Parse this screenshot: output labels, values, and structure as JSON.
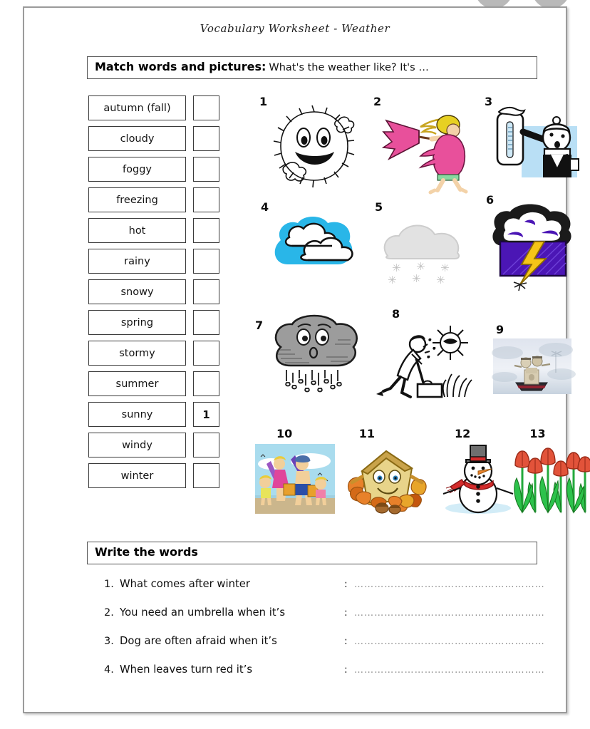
{
  "document": {
    "title": "Vocabulary Worksheet - Weather"
  },
  "section_match": {
    "heading_bold": "Match words and pictures:",
    "heading_rest": "What's the weather like? It's …"
  },
  "word_list": [
    {
      "label": "autumn (fall)",
      "answer": ""
    },
    {
      "label": "cloudy",
      "answer": ""
    },
    {
      "label": "foggy",
      "answer": ""
    },
    {
      "label": "freezing",
      "answer": ""
    },
    {
      "label": "hot",
      "answer": ""
    },
    {
      "label": "rainy",
      "answer": ""
    },
    {
      "label": "snowy",
      "answer": ""
    },
    {
      "label": "spring",
      "answer": ""
    },
    {
      "label": "stormy",
      "answer": ""
    },
    {
      "label": "summer",
      "answer": ""
    },
    {
      "label": "sunny",
      "answer": "1"
    },
    {
      "label": "windy",
      "answer": ""
    },
    {
      "label": "winter",
      "answer": ""
    }
  ],
  "pictures": [
    {
      "number": "1",
      "icon": "smiling-sun-icon",
      "meaning": "sunny"
    },
    {
      "number": "2",
      "icon": "woman-with-umbrella-wind-icon",
      "meaning": "windy"
    },
    {
      "number": "3",
      "icon": "thermometer-cold-person-icon",
      "meaning": "freezing"
    },
    {
      "number": "4",
      "icon": "clouds-blue-sky-icon",
      "meaning": "cloudy"
    },
    {
      "number": "5",
      "icon": "snow-cloud-icon",
      "meaning": "snowy"
    },
    {
      "number": "6",
      "icon": "storm-cloud-lightning-icon",
      "meaning": "stormy"
    },
    {
      "number": "7",
      "icon": "rain-cloud-sad-face-icon",
      "meaning": "rainy"
    },
    {
      "number": "8",
      "icon": "sweating-man-hot-sun-icon",
      "meaning": "hot"
    },
    {
      "number": "9",
      "icon": "foggy-boat-photo-icon",
      "meaning": "foggy"
    },
    {
      "number": "10",
      "icon": "beach-family-summer-icon",
      "meaning": "summer"
    },
    {
      "number": "11",
      "icon": "autumn-leaves-house-icon",
      "meaning": "autumn"
    },
    {
      "number": "12",
      "icon": "snowman-icon",
      "meaning": "winter"
    },
    {
      "number": "13",
      "icon": "tulips-spring-icon",
      "meaning": "spring"
    }
  ],
  "section_write": {
    "heading": "Write the words",
    "dots": "………………………………………………………",
    "colon": ":",
    "questions": [
      {
        "num": "1.",
        "text": "What comes after winter"
      },
      {
        "num": "2.",
        "text": "You need an umbrella when it’s"
      },
      {
        "num": "3.",
        "text": "Dog are often afraid when it’s"
      },
      {
        "num": "4.",
        "text": "When leaves turn red it’s"
      }
    ]
  },
  "colors": {
    "page_border": "#9b9b9b",
    "box_border": "#3a3a3a",
    "sky_blue": "#29b6e8",
    "storm_purple": "#4b16b5",
    "lightning_yellow": "#f5c518",
    "dress_pink": "#e8509b",
    "leaf_orange": "#e8812a",
    "tulip_red": "#e2533a",
    "grass_green": "#23a93c",
    "scarf_red": "#d42b2b"
  }
}
